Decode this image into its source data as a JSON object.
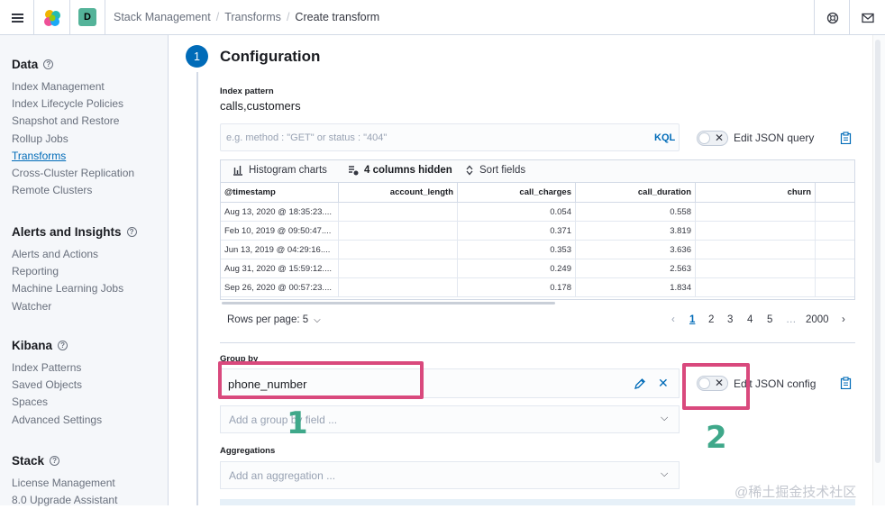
{
  "header": {
    "space_initial": "D",
    "breadcrumbs": [
      "Stack Management",
      "Transforms",
      "Create transform"
    ]
  },
  "sidebar": {
    "sections": [
      {
        "title": "Data",
        "items": [
          "Index Management",
          "Index Lifecycle Policies",
          "Snapshot and Restore",
          "Rollup Jobs",
          "Transforms",
          "Cross-Cluster Replication",
          "Remote Clusters"
        ]
      },
      {
        "title": "Alerts and Insights",
        "items": [
          "Alerts and Actions",
          "Reporting",
          "Machine Learning Jobs",
          "Watcher"
        ]
      },
      {
        "title": "Kibana",
        "items": [
          "Index Patterns",
          "Saved Objects",
          "Spaces",
          "Advanced Settings"
        ]
      },
      {
        "title": "Stack",
        "items": [
          "License Management",
          "8.0 Upgrade Assistant"
        ]
      }
    ],
    "active_item": "Transforms"
  },
  "step": {
    "number": "1",
    "title": "Configuration"
  },
  "index_pattern": {
    "label": "Index pattern",
    "value": "calls,customers"
  },
  "query": {
    "placeholder": "e.g. method : \"GET\" or status : \"404\"",
    "kql_label": "KQL",
    "toggle_label": "Edit JSON query"
  },
  "grid": {
    "toolbar": {
      "histogram": "Histogram charts",
      "hidden": "4 columns hidden",
      "sort": "Sort fields"
    },
    "columns": [
      "@timestamp",
      "account_length",
      "call_charges",
      "call_duration",
      "churn"
    ],
    "rows": [
      [
        "Aug 13, 2020 @ 18:35:23....",
        "",
        "0.054",
        "0.558",
        ""
      ],
      [
        "Feb 10, 2019 @ 09:50:47....",
        "",
        "0.371",
        "3.819",
        ""
      ],
      [
        "Jun 13, 2019 @ 04:29:16....",
        "",
        "0.353",
        "3.636",
        ""
      ],
      [
        "Aug 31, 2020 @ 15:59:12....",
        "",
        "0.249",
        "2.563",
        ""
      ],
      [
        "Sep 26, 2020 @ 00:57:23....",
        "",
        "0.178",
        "1.834",
        ""
      ]
    ],
    "rows_per_page": "Rows per page: 5",
    "pages": [
      "1",
      "2",
      "3",
      "4",
      "5",
      "…",
      "2000"
    ]
  },
  "group_by": {
    "label": "Group by",
    "value": "phone_number",
    "toggle_label": "Edit JSON config",
    "add_placeholder": "Add a group by field ..."
  },
  "aggregations": {
    "label": "Aggregations",
    "placeholder": "Add an aggregation ..."
  },
  "annotations": [
    "1",
    "2"
  ],
  "watermark": "@稀土掘金技术社区",
  "colors": {
    "accent": "#006bb8",
    "highlight": "#d9497d",
    "annotation": "#3fa88a"
  }
}
